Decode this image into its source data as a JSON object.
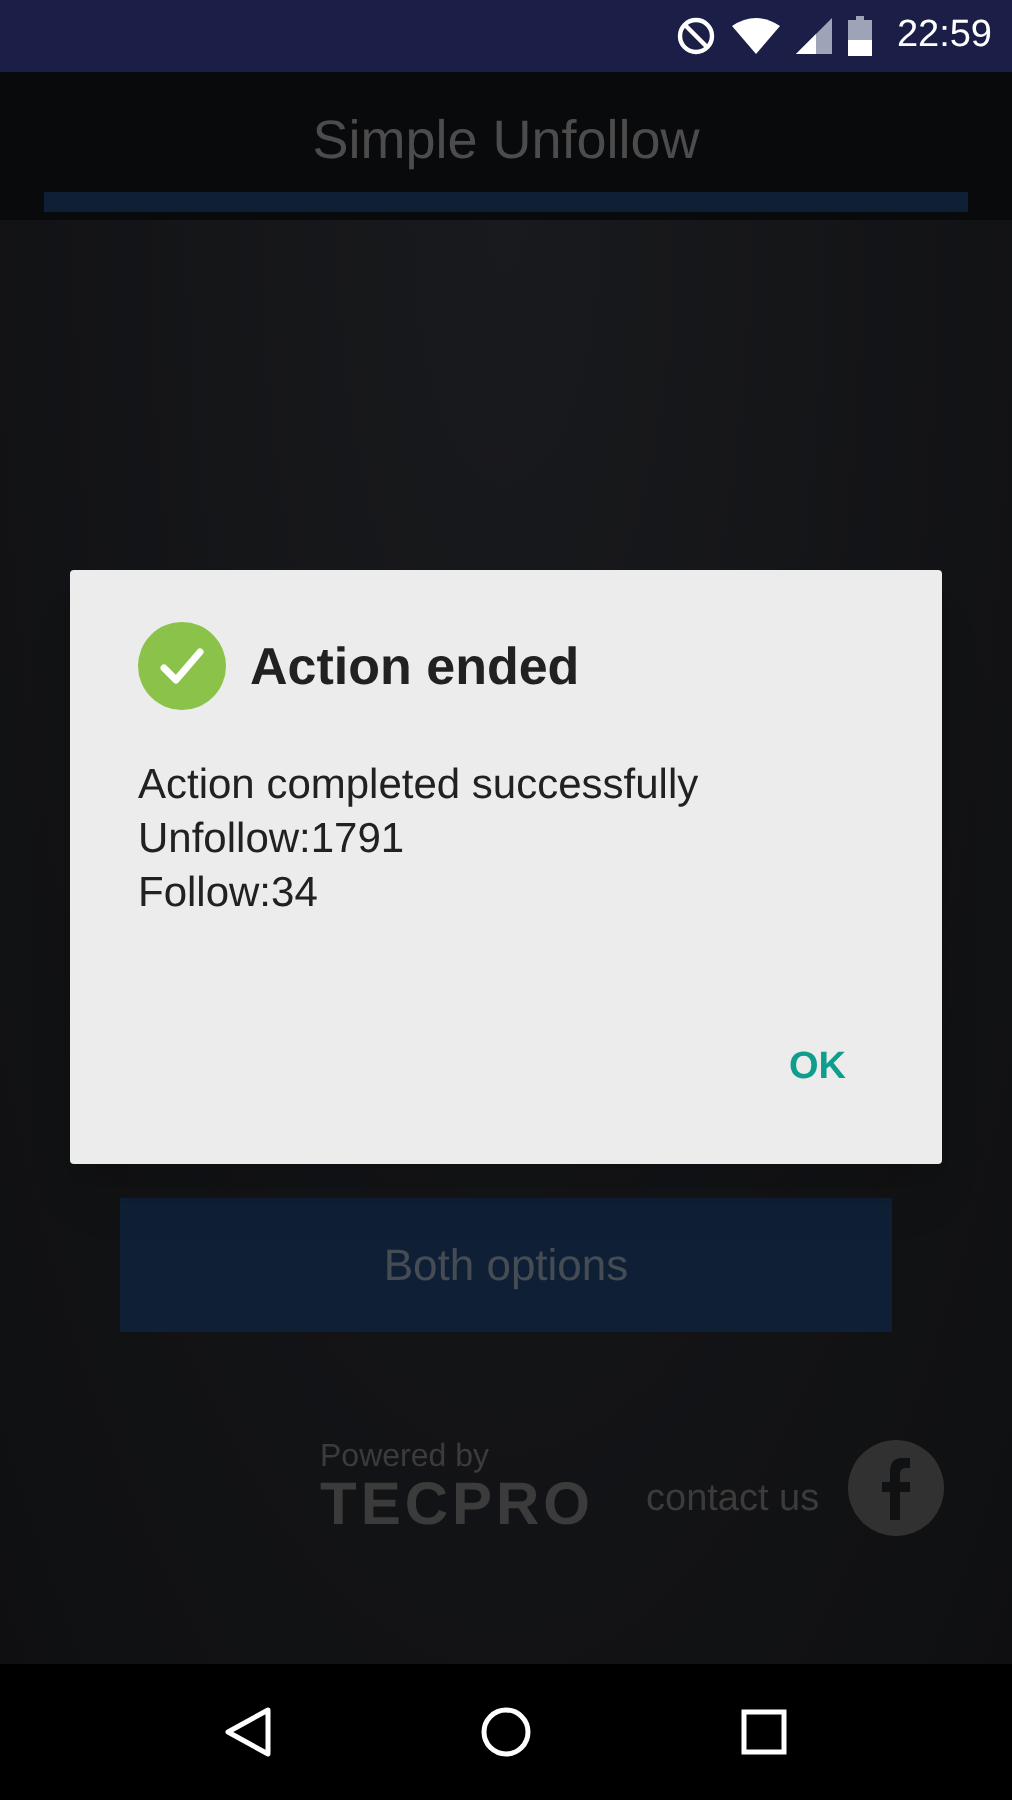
{
  "status_bar": {
    "time": "22:59"
  },
  "app": {
    "title": "Simple Unfollow"
  },
  "main": {
    "button": "Both options"
  },
  "footer": {
    "powered_by": "Powered by",
    "brand": "TECPRO",
    "contact": "contact us"
  },
  "dialog": {
    "title": "Action ended",
    "message_lines": [
      "Action completed successfully",
      "Unfollow:1791",
      "Follow:34"
    ],
    "buttons": [
      "OK"
    ]
  }
}
